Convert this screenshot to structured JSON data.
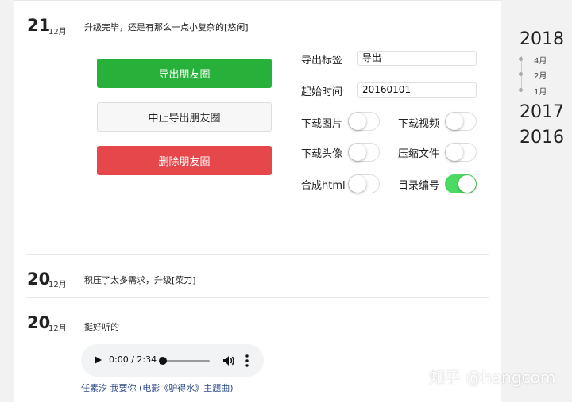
{
  "posts": [
    {
      "day": "21",
      "month": "12月",
      "text": "升级完毕，还是有那么一点小复杂的[悠闲]",
      "buttons": {
        "export": "导出朋友圈",
        "stop": "中止导出朋友圈",
        "delete": "删除朋友圈"
      },
      "fields": {
        "tag_label": "导出标签",
        "tag_value": "导出",
        "start_label": "起始时间",
        "start_value": "20160101"
      },
      "toggles": {
        "download_images": {
          "label": "下载图片",
          "on": false
        },
        "download_videos": {
          "label": "下载视频",
          "on": false
        },
        "download_avatars": {
          "label": "下载头像",
          "on": false
        },
        "compress_files": {
          "label": "压缩文件",
          "on": false
        },
        "merge_html": {
          "label": "合成html",
          "on": false
        },
        "dir_numbering": {
          "label": "目录编号",
          "on": true
        }
      }
    },
    {
      "day": "20",
      "month": "12月",
      "text": "积压了太多需求，升级[菜刀]"
    },
    {
      "day": "20",
      "month": "12月",
      "text": "挺好听的",
      "audio": {
        "time": "0:00 / 2:34",
        "progress": 0
      },
      "song": "任素汐   我要你 (电影《驴得水》主题曲)"
    }
  ],
  "timeline": {
    "years": [
      "2018",
      "2017",
      "2016"
    ],
    "months": [
      "4月",
      "2月",
      "1月"
    ]
  },
  "watermark": "知乎 @hangcom",
  "colors": {
    "green": "#27b13a",
    "red": "#e5474a",
    "toggle_on": "#4cd964",
    "link": "#2d4b8a"
  }
}
